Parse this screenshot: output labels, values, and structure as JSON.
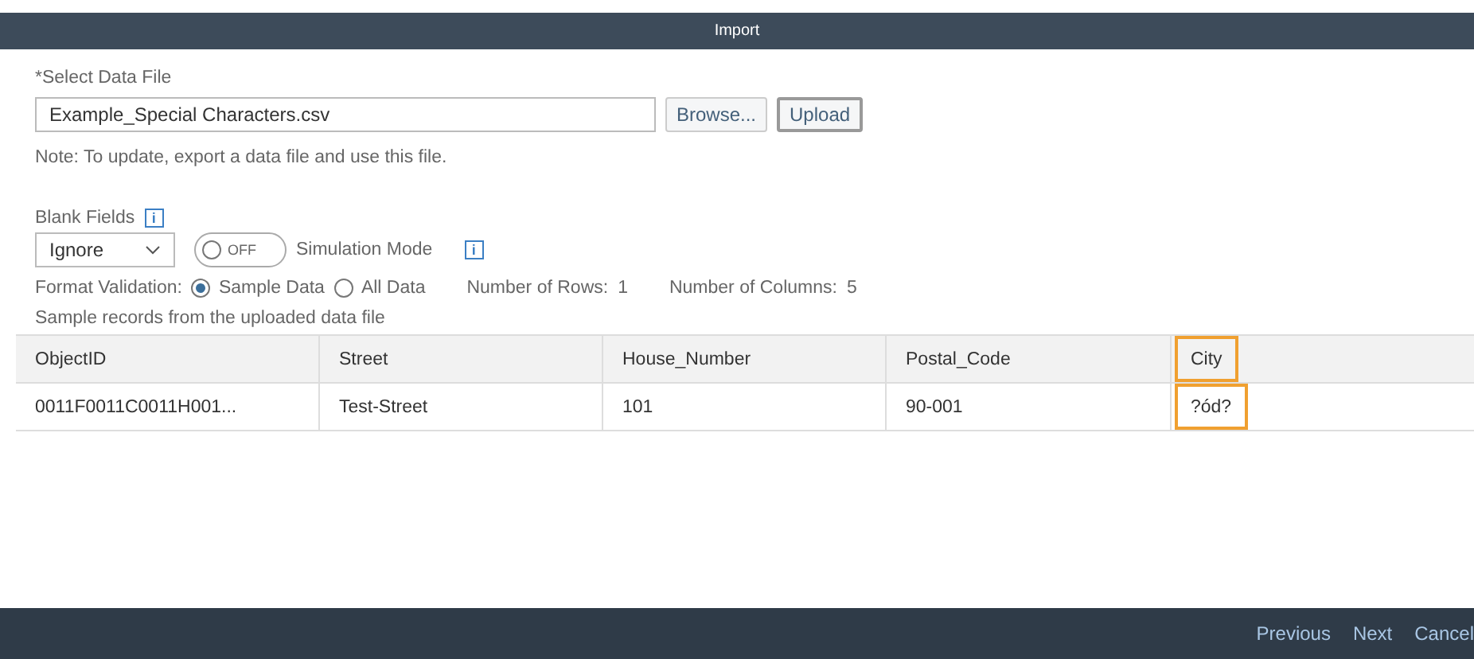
{
  "dialog": {
    "title": "Import"
  },
  "file_section": {
    "label": "*Select Data File",
    "file_name": "Example_Special Characters.csv",
    "buttons": [
      {
        "label": "Browse...",
        "kind": "plain"
      },
      {
        "label": "Upload",
        "kind": "focused"
      }
    ],
    "note": "Note: To update, export a data file and use this file."
  },
  "blank_fields": {
    "label": "Blank Fields",
    "info": "i",
    "value": "Ignore"
  },
  "simulation": {
    "on": false,
    "switch_text": "OFF",
    "label": "Simulation Mode",
    "info": "i"
  },
  "format_validation": {
    "label": "Format Validation:",
    "options": [
      {
        "label": "Sample Data",
        "selected": true
      },
      {
        "label": "All Data",
        "selected": false
      }
    ],
    "rows_label": "Number of Rows:",
    "rows_value": "1",
    "columns_label": "Number of Columns:",
    "columns_value": "5"
  },
  "table": {
    "caption": "Sample records from the uploaded data file",
    "columns": [
      {
        "label": "ObjectID",
        "highlighted": false
      },
      {
        "label": "Street",
        "highlighted": false
      },
      {
        "label": "House_Number",
        "highlighted": false
      },
      {
        "label": "Postal_Code",
        "highlighted": false
      },
      {
        "label": "City",
        "highlighted": true
      }
    ],
    "rows": [
      [
        "0011F0011C0011H001...",
        "Test-Street",
        "101",
        "90-001",
        "?ód?"
      ]
    ]
  },
  "footer": {
    "buttons": [
      "Previous",
      "Next",
      "Cancel"
    ]
  }
}
